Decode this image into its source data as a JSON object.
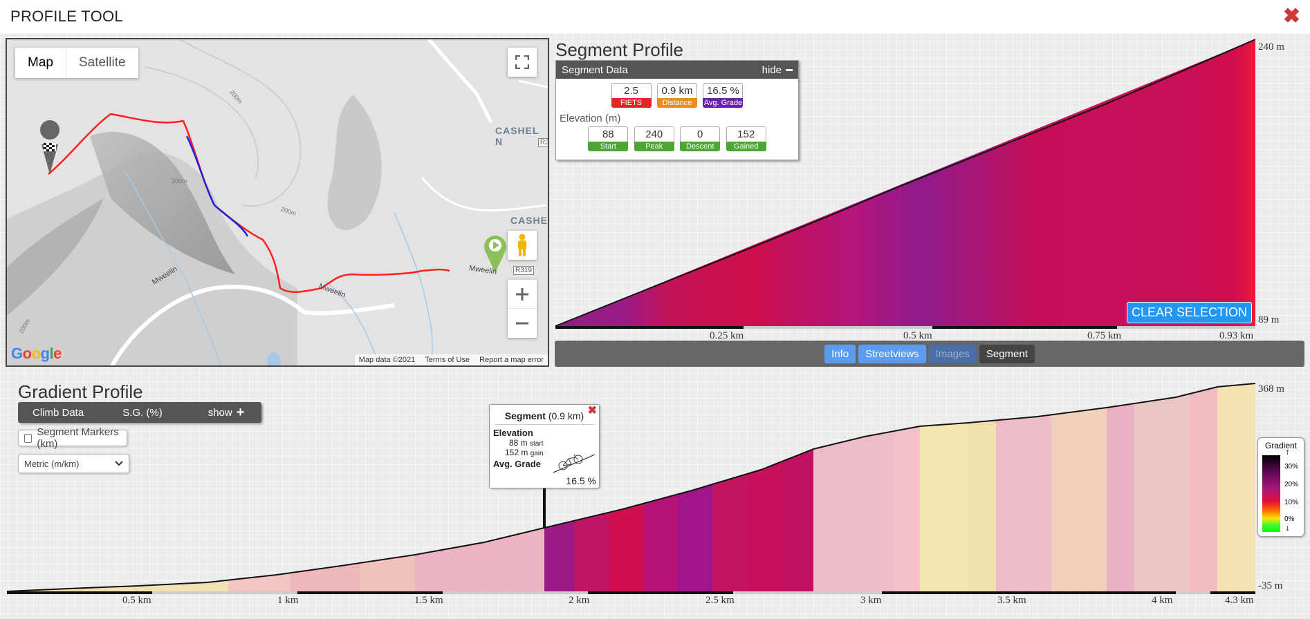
{
  "app": {
    "title": "PROFILE TOOL"
  },
  "map": {
    "type_buttons": [
      "Map",
      "Satellite"
    ],
    "labels": {
      "cashel_1": "CASHEL N",
      "cashel_2": "CASHE",
      "road_1": "Mweelin",
      "road_2": "Mweelin",
      "road_3": "Mweelin",
      "route_r319": "R319",
      "route_r3": "R3",
      "contour_1": "200m",
      "contour_2": "200m",
      "contour_3": "200m",
      "contour_4": "200m"
    },
    "attribution": [
      "Map data ©2021",
      "Terms of Use",
      "Report a map error"
    ],
    "google_logo": "Google"
  },
  "segment_profile": {
    "title": "Segment Profile",
    "panel_title": "Segment Data",
    "hide_label": "hide",
    "stats": [
      {
        "value": "2.5",
        "label": "FIETS",
        "color": "#e02828"
      },
      {
        "value": "0.9 km",
        "label": "Distance",
        "color": "#f08a1e"
      },
      {
        "value": "16.5 %",
        "label": "Avg. Grade",
        "color": "#6a1fb4"
      }
    ],
    "elevation_heading": "Elevation (m)",
    "elevation": [
      {
        "value": "88",
        "label": "Start",
        "color": "#4aa832"
      },
      {
        "value": "240",
        "label": "Peak",
        "color": "#4aa832"
      },
      {
        "value": "0",
        "label": "Descent",
        "color": "#4aa832"
      },
      {
        "value": "152",
        "label": "Gained",
        "color": "#4aa832"
      }
    ],
    "y_top": "240 m",
    "y_bottom": "89 m",
    "x_ticks": [
      "0.25 km",
      "0.5 km",
      "0.75 km",
      "0.93 km"
    ],
    "clear_button": "CLEAR SELECTION",
    "tabs": [
      "Info",
      "Streetviews",
      "Images",
      "Segment"
    ]
  },
  "gradient_profile": {
    "title": "Gradient Profile",
    "climb_bar": {
      "climb_data": "Climb Data",
      "sg": "S.G. (%)",
      "show": "show"
    },
    "segment_markers_label": "Segment Markers (km)",
    "units_select": "Metric (m/km)",
    "y_top": "368 m",
    "y_bottom": "-35 m",
    "x_ticks": [
      "0.5 km",
      "1 km",
      "1.5 km",
      "2 km",
      "2.5 km",
      "3 km",
      "3.5 km",
      "4 km",
      "4.3 km"
    ],
    "tooltip": {
      "title": "Segment",
      "distance": "(0.9 km)",
      "elevation_heading": "Elevation",
      "start_value": "88 m",
      "start_label": "start",
      "gain_value": "152 m",
      "gain_label": "gain",
      "avg_grade_label": "Avg. Grade",
      "avg_grade_value": "16.5 %"
    },
    "legend": {
      "title": "Gradient",
      "ticks": [
        "30%",
        "20%",
        "10%",
        "0%"
      ]
    }
  }
}
